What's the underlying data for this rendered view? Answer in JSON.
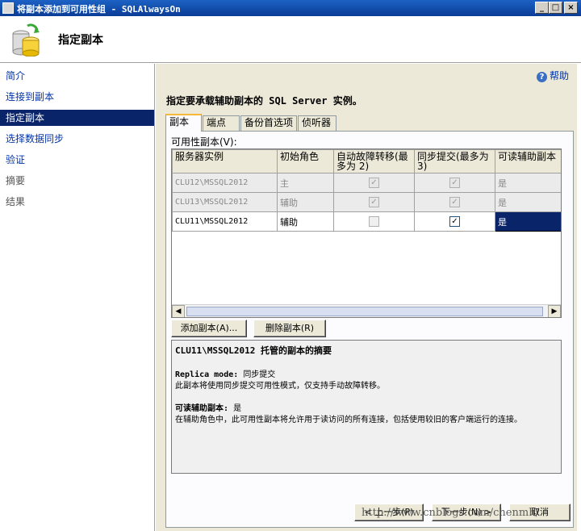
{
  "window": {
    "title": "将副本添加到可用性组 - SQLAlwaysOn",
    "minimize": "_",
    "maximize": "□",
    "close": "×"
  },
  "header": {
    "title": "指定副本"
  },
  "nav": {
    "items": [
      {
        "label": "简介",
        "state": "link"
      },
      {
        "label": "连接到副本",
        "state": "link"
      },
      {
        "label": "指定副本",
        "state": "active"
      },
      {
        "label": "选择数据同步",
        "state": "link"
      },
      {
        "label": "验证",
        "state": "link"
      },
      {
        "label": "摘要",
        "state": "disabled"
      },
      {
        "label": "结果",
        "state": "disabled"
      }
    ]
  },
  "help": {
    "label": "帮助"
  },
  "instruction": "指定要承载辅助副本的 SQL Server 实例。",
  "tabs": [
    {
      "label": "副本",
      "active": true
    },
    {
      "label": "端点",
      "active": false
    },
    {
      "label": "备份首选项",
      "active": false
    },
    {
      "label": "侦听器",
      "active": false
    }
  ],
  "grid": {
    "label": "可用性副本(V):",
    "columns": [
      "服务器实例",
      "初始角色",
      "自动故障转移(最多为 2)",
      "同步提交(最多为 3)",
      "可读辅助副本"
    ],
    "rows": [
      {
        "server": "CLU12\\MSSQL2012",
        "role": "主",
        "auto_failover": true,
        "sync_commit": true,
        "readable": "是",
        "editable": false
      },
      {
        "server": "CLU13\\MSSQL2012",
        "role": "辅助",
        "auto_failover": true,
        "sync_commit": true,
        "readable": "是",
        "editable": false
      },
      {
        "server": "CLU11\\MSSQL2012",
        "role": "辅助",
        "auto_failover": false,
        "sync_commit": true,
        "readable": "是",
        "editable": true
      }
    ]
  },
  "buttons": {
    "add_replica": "添加副本(A)...",
    "remove_replica": "删除副本(R)",
    "previous": "< 上一步(P)",
    "next": "下一步(N) >",
    "cancel": "取消"
  },
  "summary": {
    "title": "CLU11\\MSSQL2012 托管的副本的摘要",
    "replica_mode_label": "Replica mode:",
    "replica_mode_value": "同步提交",
    "replica_mode_desc": "此副本将使用同步提交可用性模式，仅支持手动故障转移。",
    "readable_label": "可读辅助副本:",
    "readable_value": "是",
    "readable_desc": "在辅助角色中，此可用性副本将允许用于读访问的所有连接，包括使用较旧的客户端运行的连接。"
  },
  "watermark": "http://www.cnblogs.com/chenmh/"
}
